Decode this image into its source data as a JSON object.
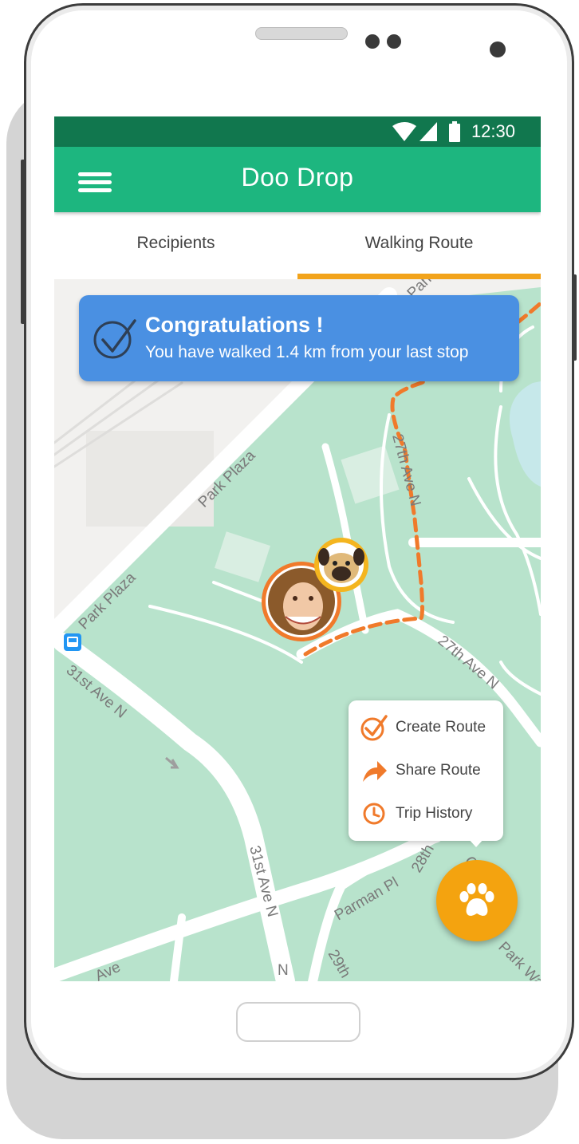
{
  "status_bar": {
    "time": "12:30"
  },
  "app_bar": {
    "title": "Doo Drop"
  },
  "tabs": [
    {
      "label": "Recipients",
      "active": false
    },
    {
      "label": "Walking Route",
      "active": true
    }
  ],
  "banner": {
    "title": "Congratulations !",
    "message": "You have walked 1.4 km from your last stop",
    "icon": "check-circle-icon"
  },
  "map": {
    "street_labels": [
      "Park Plaza",
      "Park Plaza",
      "Park Plaza",
      "27th Ave N",
      "27th Ave N",
      "31st Ave N",
      "31st Ave N",
      "Parman Pl",
      "28th",
      "29th",
      "Ave",
      "Park Wa",
      "N",
      "C"
    ],
    "markers": [
      {
        "type": "person-avatar",
        "icon": "person-avatar"
      },
      {
        "type": "dog-avatar",
        "icon": "pug-icon"
      },
      {
        "type": "bus-stop",
        "icon": "bus-icon"
      }
    ]
  },
  "popup_menu": {
    "items": [
      {
        "label": "Create Route",
        "icon": "check-icon"
      },
      {
        "label": "Share Route",
        "icon": "share-arrow-icon"
      },
      {
        "label": "Trip History",
        "icon": "clock-icon"
      }
    ]
  },
  "fab": {
    "icon": "paw-icon"
  },
  "colors": {
    "status_bar": "#11774e",
    "app_bar": "#1db67f",
    "tab_indicator": "#f2a31b",
    "banner": "#4a90e2",
    "route": "#f07a2b",
    "fab": "#f4a30f",
    "park": "#b8e3cc"
  }
}
